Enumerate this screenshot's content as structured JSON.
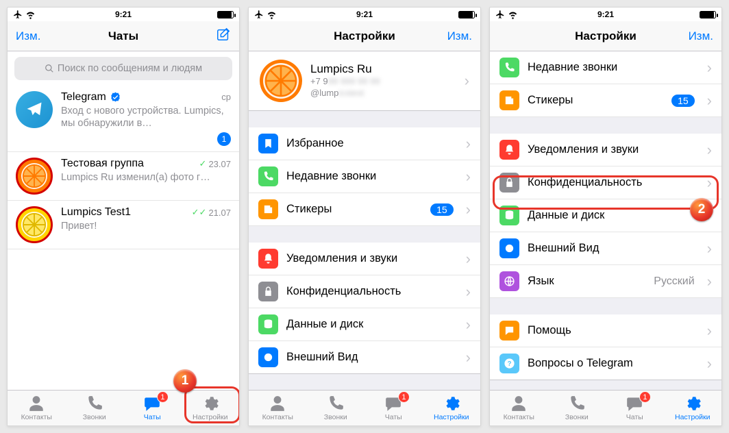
{
  "statusbar": {
    "time": "9:21"
  },
  "nav": {
    "edit_label": "Изм.",
    "chats_title": "Чаты",
    "settings_title": "Настройки"
  },
  "search": {
    "placeholder": "Поиск по сообщениям и людям"
  },
  "chats": [
    {
      "name": "Telegram",
      "verified": true,
      "date": "ср",
      "preview": "Вход с нового устройства. Lumpics, мы обнаружили в…",
      "unread": "1"
    },
    {
      "name": "Тестовая группа",
      "checks": "✓",
      "date": "23.07",
      "preview": "Lumpics Ru изменил(а) фото г…"
    },
    {
      "name": "Lumpics Test1",
      "checks": "✓✓",
      "date": "21.07",
      "preview": "Привет!"
    }
  ],
  "profile": {
    "name": "Lumpics Ru",
    "phone": "+7 9",
    "username": "@lump"
  },
  "settings_items": {
    "favorites": "Избранное",
    "recent_calls": "Недавние звонки",
    "stickers": "Стикеры",
    "stickers_badge": "15",
    "notifications": "Уведомления и звуки",
    "privacy": "Конфиденциальность",
    "data": "Данные и диск",
    "appearance": "Внешний Вид",
    "language": "Язык",
    "language_value": "Русский",
    "help": "Помощь",
    "faq": "Вопросы о Telegram"
  },
  "tabs": {
    "contacts": "Контакты",
    "calls": "Звонки",
    "chats": "Чаты",
    "settings": "Настройки",
    "chats_badge": "1"
  },
  "colors": {
    "accent": "#007aff",
    "icons": {
      "favorites": "#007aff",
      "recent_calls": "#4cd964",
      "stickers": "#ff9500",
      "notifications": "#ff3b30",
      "privacy": "#8e8e93",
      "data": "#4cd964",
      "appearance": "#007aff",
      "language": "#af52de",
      "help": "#ff9500",
      "faq": "#5ac8fa"
    }
  },
  "callouts": {
    "one": "1",
    "two": "2"
  }
}
